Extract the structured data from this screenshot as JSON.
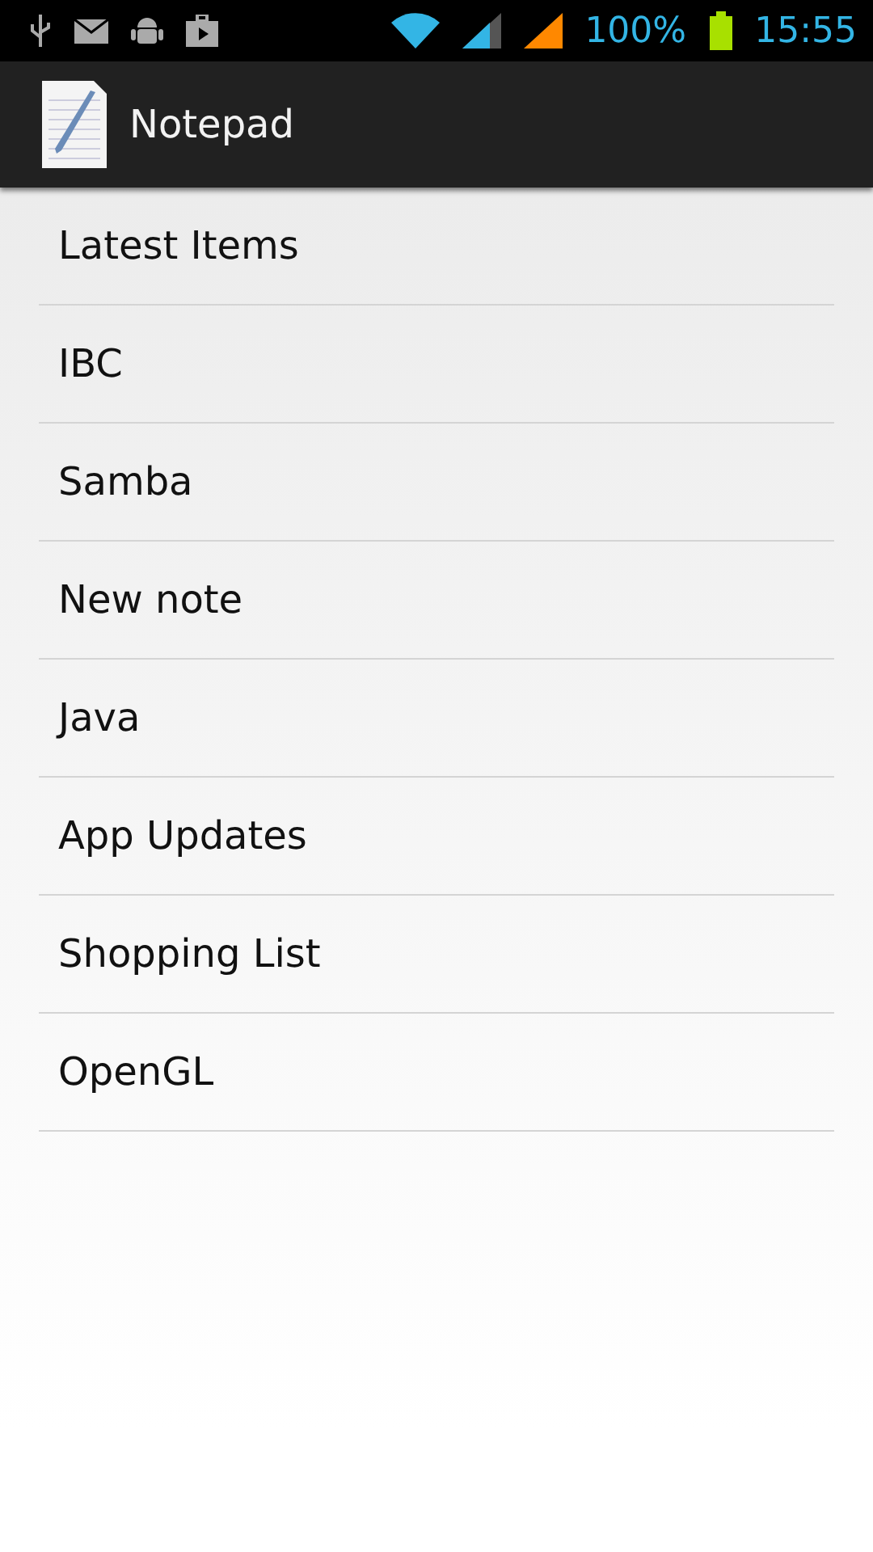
{
  "status_bar": {
    "battery": "100%",
    "time": "15:55"
  },
  "action_bar": {
    "title": "Notepad"
  },
  "notes": [
    {
      "title": "Latest Items"
    },
    {
      "title": "IBC"
    },
    {
      "title": "Samba"
    },
    {
      "title": "New note"
    },
    {
      "title": "Java"
    },
    {
      "title": "App Updates"
    },
    {
      "title": "Shopping List"
    },
    {
      "title": "OpenGL"
    }
  ]
}
